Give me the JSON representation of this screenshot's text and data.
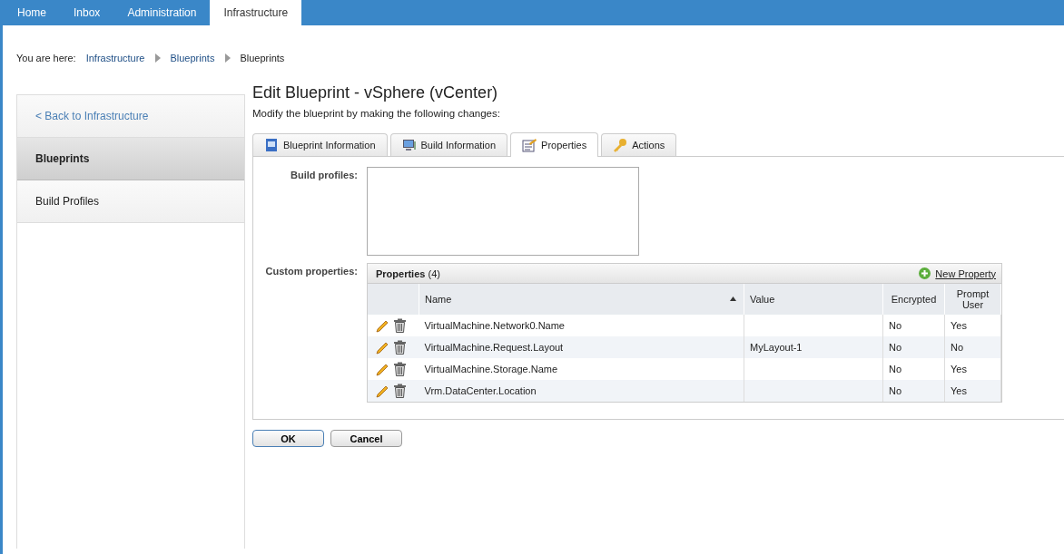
{
  "top_nav": [
    {
      "label": "Home",
      "selected": false
    },
    {
      "label": "Inbox",
      "selected": false
    },
    {
      "label": "Administration",
      "selected": false
    },
    {
      "label": "Infrastructure",
      "selected": true
    }
  ],
  "breadcrumb": {
    "prefix": "You are here:",
    "items": [
      "Infrastructure",
      "Blueprints",
      "Blueprints"
    ]
  },
  "sidebar": {
    "back_link": "< Back to Infrastructure",
    "items": [
      {
        "label": "Blueprints",
        "selected": true
      },
      {
        "label": "Build Profiles",
        "selected": false
      }
    ]
  },
  "page": {
    "title": "Edit Blueprint - vSphere (vCenter)",
    "subtitle": "Modify the blueprint by making the following changes:"
  },
  "tabs": [
    {
      "label": "Blueprint Information",
      "kind": "document",
      "selected": false
    },
    {
      "label": "Build Information",
      "kind": "monitor",
      "selected": false
    },
    {
      "label": "Properties",
      "kind": "form",
      "selected": true
    },
    {
      "label": "Actions",
      "kind": "key",
      "selected": false
    }
  ],
  "build_profiles_label": "Build profiles:",
  "custom_properties_label": "Custom properties:",
  "properties_panel": {
    "title": "**Properties** (4)",
    "new_property": "New Property"
  },
  "table": {
    "columns": [
      "Name",
      "Value",
      "Encrypted",
      "Prompt User"
    ],
    "rows": [
      {
        "name": "VirtualMachine.Network0.Name",
        "value": "",
        "encrypted": "No",
        "prompt_user": "Yes"
      },
      {
        "name": "VirtualMachine.Request.Layout",
        "value": "MyLayout-1",
        "encrypted": "No",
        "prompt_user": "No"
      },
      {
        "name": "VirtualMachine.Storage.Name",
        "value": "",
        "encrypted": "No",
        "prompt_user": "Yes"
      },
      {
        "name": "Vrm.DataCenter.Location",
        "value": "",
        "encrypted": "No",
        "prompt_user": "Yes"
      }
    ]
  },
  "buttons": [
    "OK",
    "Cancel"
  ]
}
